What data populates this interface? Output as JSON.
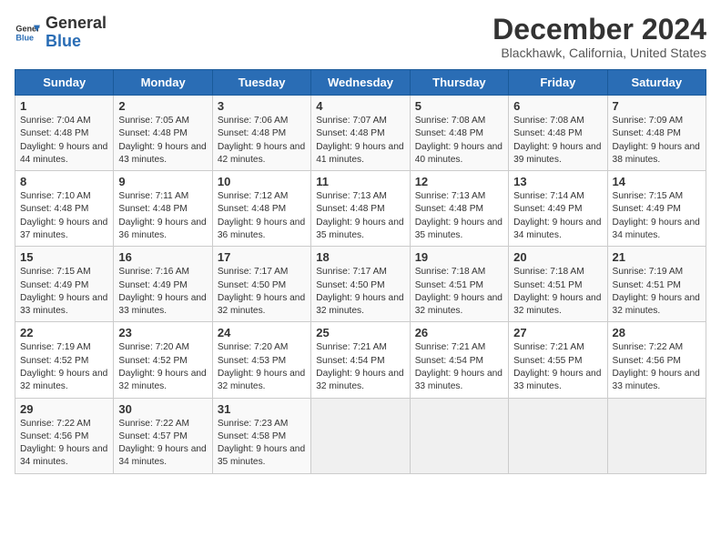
{
  "header": {
    "logo_text_general": "General",
    "logo_text_blue": "Blue",
    "title": "December 2024",
    "subtitle": "Blackhawk, California, United States"
  },
  "days_of_week": [
    "Sunday",
    "Monday",
    "Tuesday",
    "Wednesday",
    "Thursday",
    "Friday",
    "Saturday"
  ],
  "weeks": [
    [
      {
        "day": 1,
        "rise": "7:04 AM",
        "set": "4:48 PM",
        "daylight": "9 hours and 44 minutes."
      },
      {
        "day": 2,
        "rise": "7:05 AM",
        "set": "4:48 PM",
        "daylight": "9 hours and 43 minutes."
      },
      {
        "day": 3,
        "rise": "7:06 AM",
        "set": "4:48 PM",
        "daylight": "9 hours and 42 minutes."
      },
      {
        "day": 4,
        "rise": "7:07 AM",
        "set": "4:48 PM",
        "daylight": "9 hours and 41 minutes."
      },
      {
        "day": 5,
        "rise": "7:08 AM",
        "set": "4:48 PM",
        "daylight": "9 hours and 40 minutes."
      },
      {
        "day": 6,
        "rise": "7:08 AM",
        "set": "4:48 PM",
        "daylight": "9 hours and 39 minutes."
      },
      {
        "day": 7,
        "rise": "7:09 AM",
        "set": "4:48 PM",
        "daylight": "9 hours and 38 minutes."
      }
    ],
    [
      {
        "day": 8,
        "rise": "7:10 AM",
        "set": "4:48 PM",
        "daylight": "9 hours and 37 minutes."
      },
      {
        "day": 9,
        "rise": "7:11 AM",
        "set": "4:48 PM",
        "daylight": "9 hours and 36 minutes."
      },
      {
        "day": 10,
        "rise": "7:12 AM",
        "set": "4:48 PM",
        "daylight": "9 hours and 36 minutes."
      },
      {
        "day": 11,
        "rise": "7:13 AM",
        "set": "4:48 PM",
        "daylight": "9 hours and 35 minutes."
      },
      {
        "day": 12,
        "rise": "7:13 AM",
        "set": "4:48 PM",
        "daylight": "9 hours and 35 minutes."
      },
      {
        "day": 13,
        "rise": "7:14 AM",
        "set": "4:49 PM",
        "daylight": "9 hours and 34 minutes."
      },
      {
        "day": 14,
        "rise": "7:15 AM",
        "set": "4:49 PM",
        "daylight": "9 hours and 34 minutes."
      }
    ],
    [
      {
        "day": 15,
        "rise": "7:15 AM",
        "set": "4:49 PM",
        "daylight": "9 hours and 33 minutes."
      },
      {
        "day": 16,
        "rise": "7:16 AM",
        "set": "4:49 PM",
        "daylight": "9 hours and 33 minutes."
      },
      {
        "day": 17,
        "rise": "7:17 AM",
        "set": "4:50 PM",
        "daylight": "9 hours and 32 minutes."
      },
      {
        "day": 18,
        "rise": "7:17 AM",
        "set": "4:50 PM",
        "daylight": "9 hours and 32 minutes."
      },
      {
        "day": 19,
        "rise": "7:18 AM",
        "set": "4:51 PM",
        "daylight": "9 hours and 32 minutes."
      },
      {
        "day": 20,
        "rise": "7:18 AM",
        "set": "4:51 PM",
        "daylight": "9 hours and 32 minutes."
      },
      {
        "day": 21,
        "rise": "7:19 AM",
        "set": "4:51 PM",
        "daylight": "9 hours and 32 minutes."
      }
    ],
    [
      {
        "day": 22,
        "rise": "7:19 AM",
        "set": "4:52 PM",
        "daylight": "9 hours and 32 minutes."
      },
      {
        "day": 23,
        "rise": "7:20 AM",
        "set": "4:52 PM",
        "daylight": "9 hours and 32 minutes."
      },
      {
        "day": 24,
        "rise": "7:20 AM",
        "set": "4:53 PM",
        "daylight": "9 hours and 32 minutes."
      },
      {
        "day": 25,
        "rise": "7:21 AM",
        "set": "4:54 PM",
        "daylight": "9 hours and 32 minutes."
      },
      {
        "day": 26,
        "rise": "7:21 AM",
        "set": "4:54 PM",
        "daylight": "9 hours and 33 minutes."
      },
      {
        "day": 27,
        "rise": "7:21 AM",
        "set": "4:55 PM",
        "daylight": "9 hours and 33 minutes."
      },
      {
        "day": 28,
        "rise": "7:22 AM",
        "set": "4:56 PM",
        "daylight": "9 hours and 33 minutes."
      }
    ],
    [
      {
        "day": 29,
        "rise": "7:22 AM",
        "set": "4:56 PM",
        "daylight": "9 hours and 34 minutes."
      },
      {
        "day": 30,
        "rise": "7:22 AM",
        "set": "4:57 PM",
        "daylight": "9 hours and 34 minutes."
      },
      {
        "day": 31,
        "rise": "7:23 AM",
        "set": "4:58 PM",
        "daylight": "9 hours and 35 minutes."
      },
      null,
      null,
      null,
      null
    ]
  ]
}
